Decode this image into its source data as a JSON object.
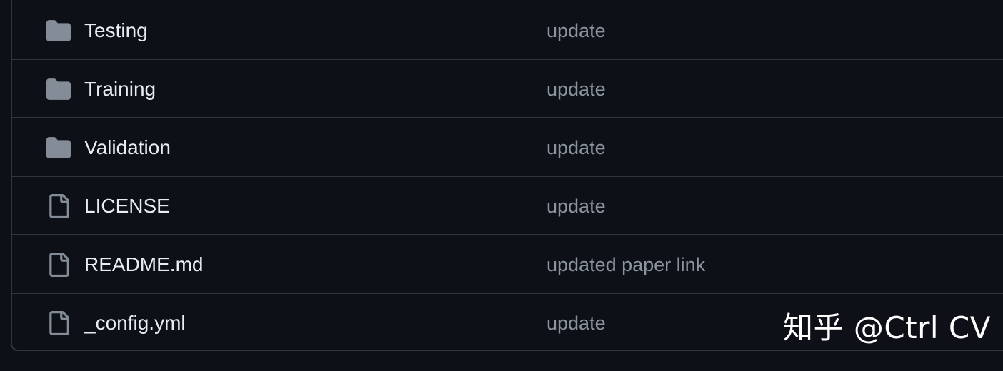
{
  "files": [
    {
      "name": "Testing",
      "type": "folder",
      "icon": "folder-icon",
      "commit_message": "update"
    },
    {
      "name": "Training",
      "type": "folder",
      "icon": "folder-icon",
      "commit_message": "update"
    },
    {
      "name": "Validation",
      "type": "folder",
      "icon": "folder-icon",
      "commit_message": "update"
    },
    {
      "name": "LICENSE",
      "type": "file",
      "icon": "file-icon",
      "commit_message": "update"
    },
    {
      "name": "README.md",
      "type": "file",
      "icon": "file-icon",
      "commit_message": "updated paper link"
    },
    {
      "name": "_config.yml",
      "type": "file",
      "icon": "file-icon",
      "commit_message": "update"
    }
  ],
  "watermark": "知乎 @Ctrl CV",
  "colors": {
    "background": "#0d1117",
    "border": "#30363d",
    "text_primary": "#e6edf3",
    "text_muted": "#8b949e",
    "icon_fill": "#848d97"
  }
}
